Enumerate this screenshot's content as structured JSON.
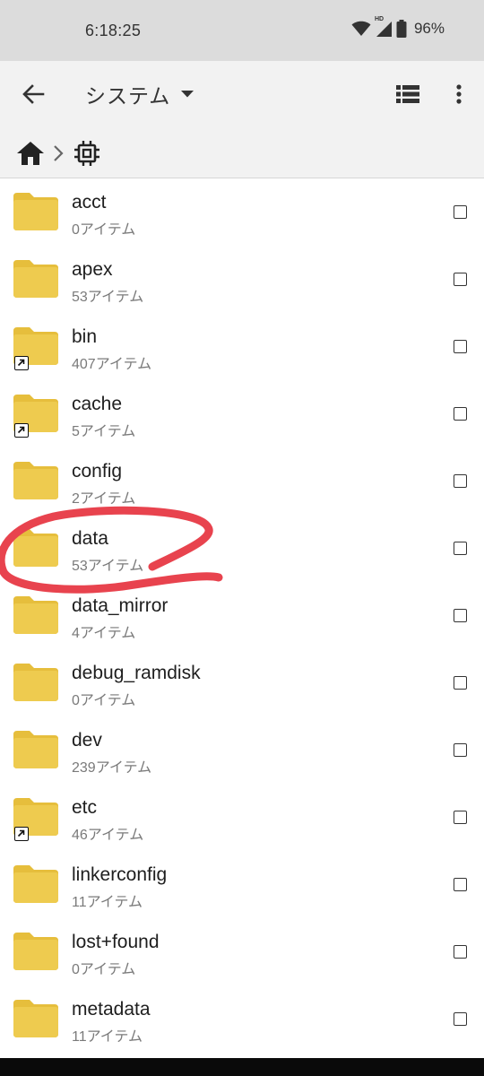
{
  "status_bar": {
    "time": "6:18:25",
    "hd_label": "HD",
    "battery": "96%"
  },
  "app_bar": {
    "title": "システム",
    "icons": [
      "back-arrow-icon",
      "dropdown-caret-icon",
      "list-view-icon",
      "more-vert-icon"
    ]
  },
  "breadcrumb": {
    "icons": [
      "home-icon",
      "chevron-right-icon",
      "chip-icon"
    ]
  },
  "files": [
    {
      "name": "acct",
      "count": "0アイテム",
      "link": false
    },
    {
      "name": "apex",
      "count": "53アイテム",
      "link": false
    },
    {
      "name": "bin",
      "count": "407アイテム",
      "link": true
    },
    {
      "name": "cache",
      "count": "5アイテム",
      "link": true
    },
    {
      "name": "config",
      "count": "2アイテム",
      "link": false
    },
    {
      "name": "data",
      "count": "53アイテム",
      "link": false
    },
    {
      "name": "data_mirror",
      "count": "4アイテム",
      "link": false
    },
    {
      "name": "debug_ramdisk",
      "count": "0アイテム",
      "link": false
    },
    {
      "name": "dev",
      "count": "239アイテム",
      "link": false
    },
    {
      "name": "etc",
      "count": "46アイテム",
      "link": true
    },
    {
      "name": "linkerconfig",
      "count": "11アイテム",
      "link": false
    },
    {
      "name": "lost+found",
      "count": "0アイテム",
      "link": false
    },
    {
      "name": "metadata",
      "count": "11アイテム",
      "link": false
    }
  ],
  "colors": {
    "folder": "#EECB4F",
    "folder_tab": "#E6BE3C",
    "annotation": "#E8434E",
    "status_bar_bg": "#DCDCDC",
    "app_bar_bg": "#F2F2F2"
  }
}
